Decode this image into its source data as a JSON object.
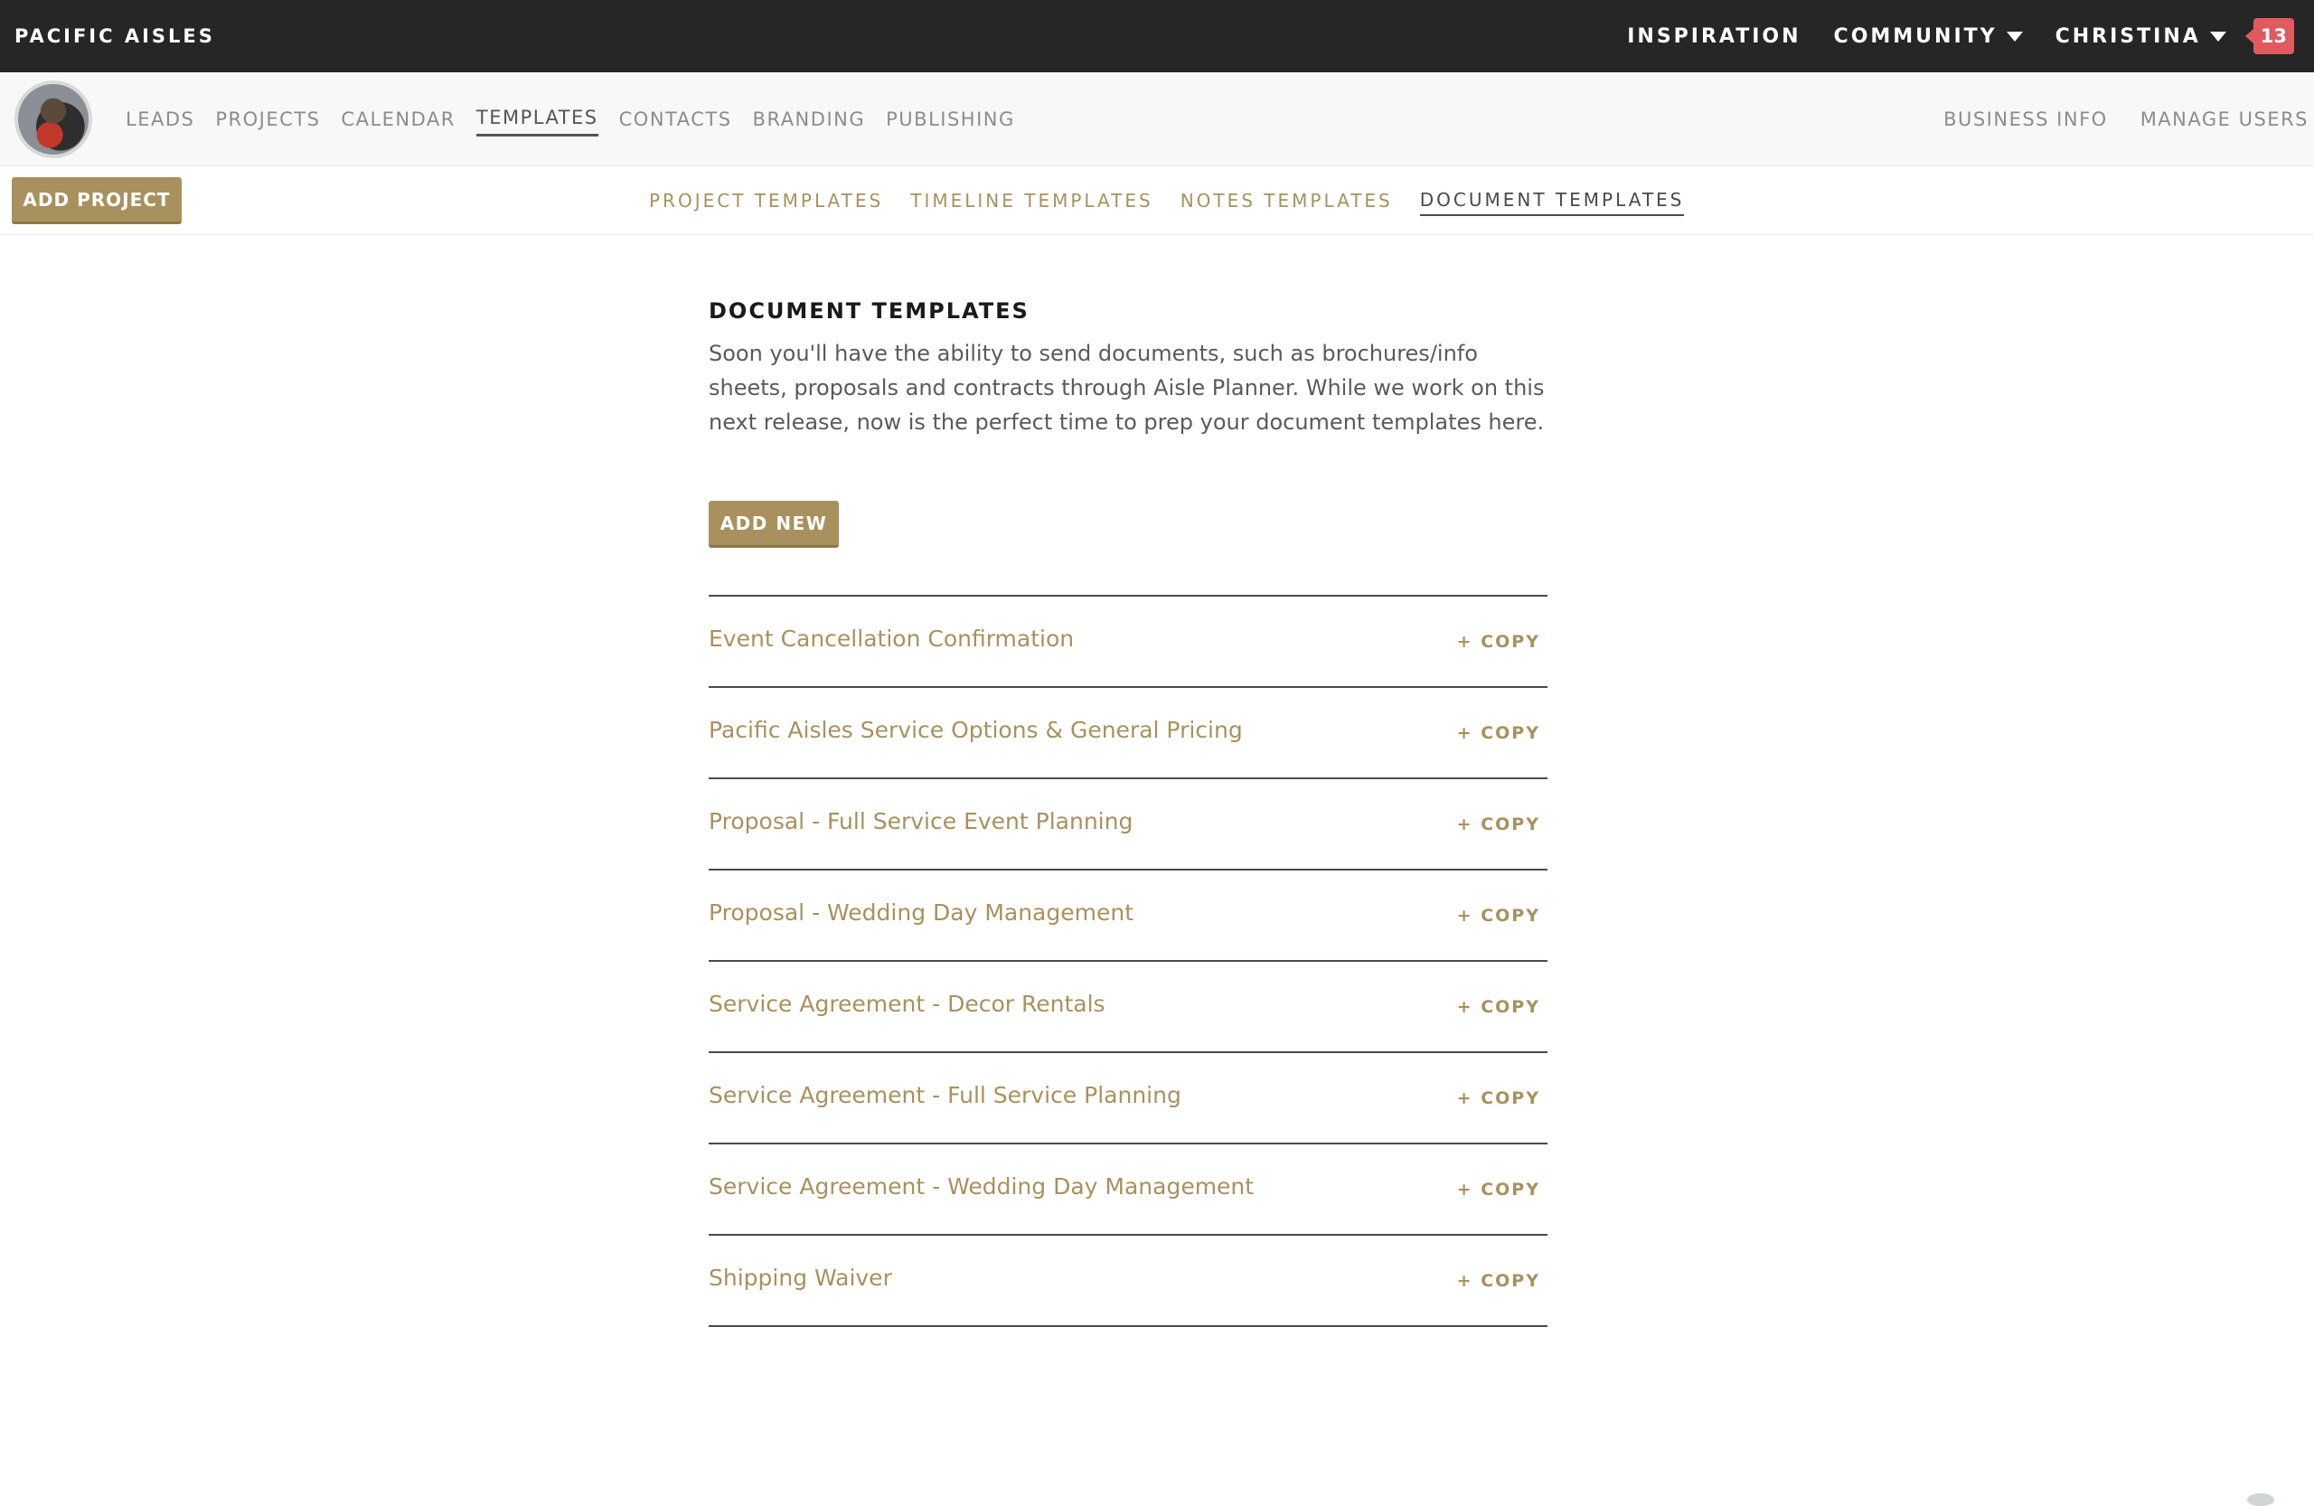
{
  "brand": "PACIFIC AISLES",
  "topnav": {
    "inspiration": "INSPIRATION",
    "community": "COMMUNITY",
    "user": "CHRISTINA",
    "notifications": "13"
  },
  "mainnav": {
    "items": [
      "LEADS",
      "PROJECTS",
      "CALENDAR",
      "TEMPLATES",
      "CONTACTS",
      "BRANDING",
      "PUBLISHING"
    ],
    "active": "TEMPLATES",
    "right": [
      "BUSINESS INFO",
      "MANAGE USERS"
    ]
  },
  "subbar": {
    "add_project": "ADD PROJECT",
    "tabs": [
      "PROJECT TEMPLATES",
      "TIMELINE TEMPLATES",
      "NOTES TEMPLATES",
      "DOCUMENT TEMPLATES"
    ],
    "active": "DOCUMENT TEMPLATES"
  },
  "content": {
    "title": "DOCUMENT TEMPLATES",
    "intro": "Soon you'll have the ability to send documents, such as brochures/info sheets, proposals and contracts through Aisle Planner. While we work on this next release, now is the perfect time to prep your document templates here.",
    "add_new": "ADD NEW",
    "copy_label": "+ COPY",
    "templates": [
      "Event Cancellation Confirmation",
      "Pacific Aisles Service Options & General Pricing",
      "Proposal - Full Service Event Planning",
      "Proposal - Wedding Day Management",
      "Service Agreement - Decor Rentals",
      "Service Agreement - Full Service Planning",
      "Service Agreement - Wedding Day Management",
      "Shipping Waiver"
    ]
  },
  "colors": {
    "accent": "#a8915e",
    "topbar": "#262626",
    "badge": "#e05a5f"
  }
}
